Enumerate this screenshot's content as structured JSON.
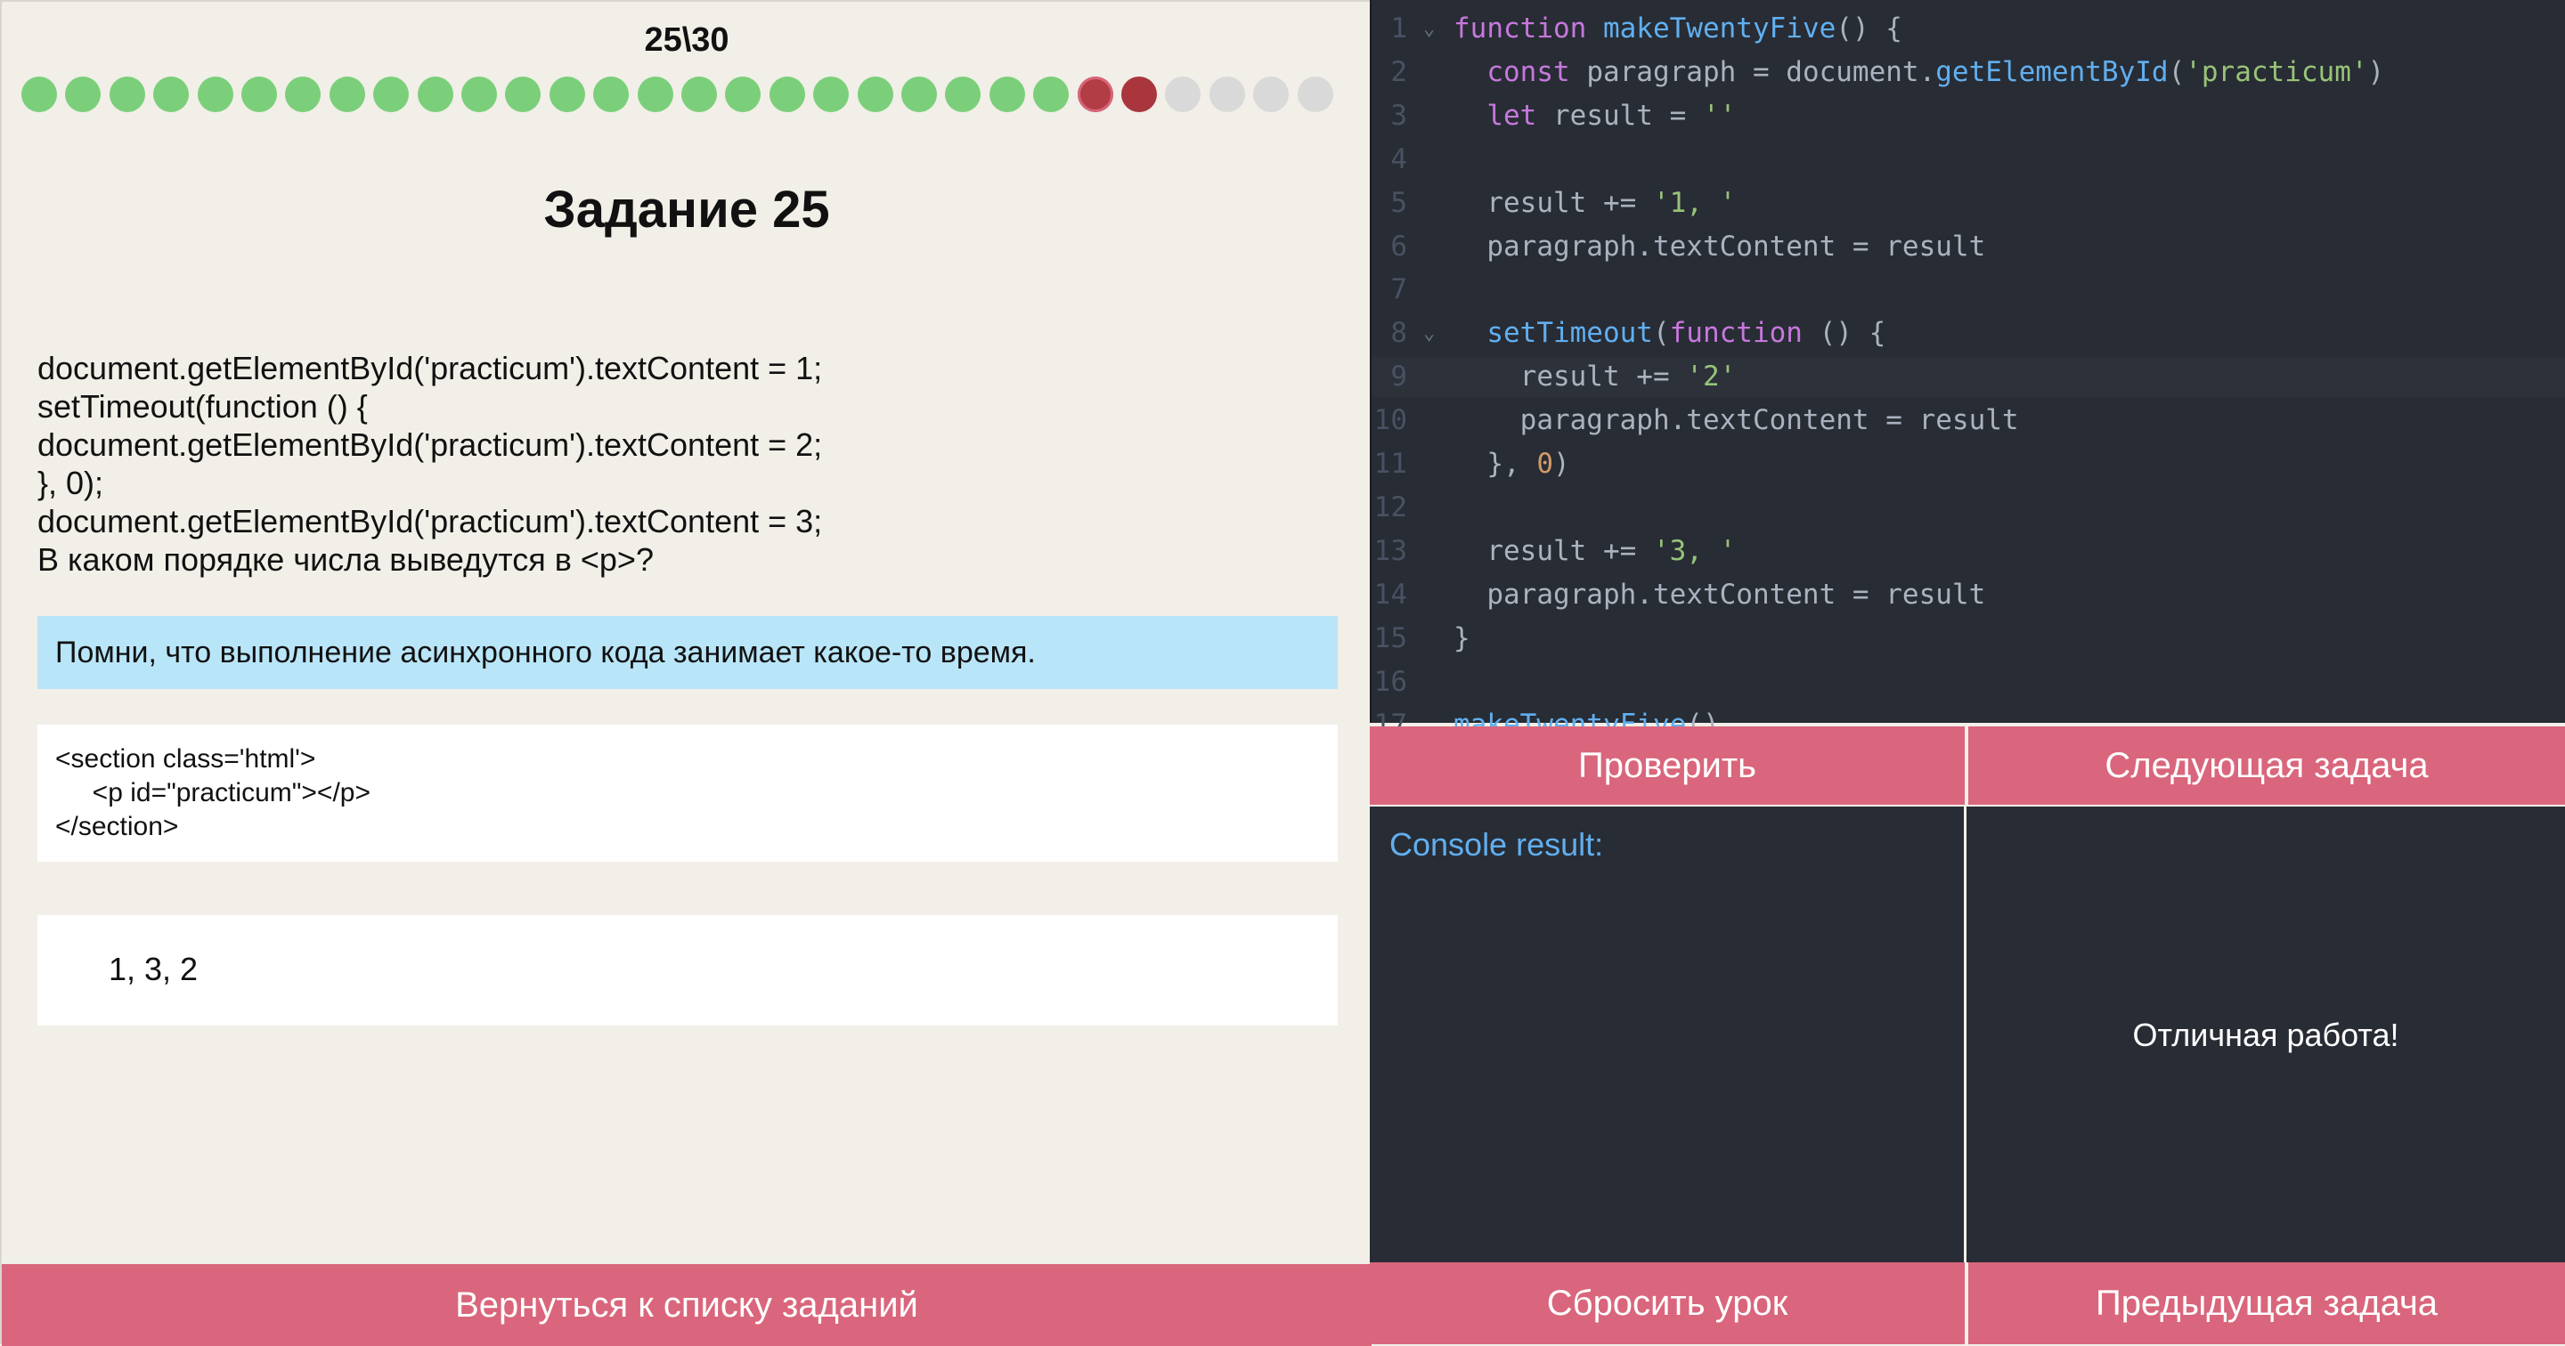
{
  "progress": {
    "counter": "25\\30",
    "dots": [
      "done",
      "done",
      "done",
      "done",
      "done",
      "done",
      "done",
      "done",
      "done",
      "done",
      "done",
      "done",
      "done",
      "done",
      "done",
      "done",
      "done",
      "done",
      "done",
      "done",
      "done",
      "done",
      "done",
      "done",
      "current",
      "wrong",
      "pending",
      "pending",
      "pending",
      "pending"
    ]
  },
  "task": {
    "title": "Задание 25",
    "lines": [
      "document.getElementById('practicum').textContent = 1;",
      "setTimeout(function () {",
      "document.getElementById('practicum').textContent = 2;",
      "}, 0);",
      "document.getElementById('practicum').textContent = 3;",
      "В каком порядке числа выведутся в <p>?"
    ],
    "hint": "Помни, что выполнение асинхронного кода занимает какое-то время.",
    "html_lines": [
      "<section class='html'>",
      "     <p id=\"practicum\"></p>",
      "</section>"
    ],
    "answer": "1, 3, 2",
    "back_label": "Вернуться к списку заданий"
  },
  "editor": {
    "active_line": 9,
    "folds": [
      1,
      8
    ],
    "lines": [
      [
        [
          "kw",
          "function"
        ],
        [
          "p",
          " "
        ],
        [
          "fn",
          "makeTwentyFive"
        ],
        [
          "p",
          "() {"
        ]
      ],
      [
        [
          "p",
          "  "
        ],
        [
          "kw",
          "const"
        ],
        [
          "p",
          " paragraph = document."
        ],
        [
          "fn",
          "getElementById"
        ],
        [
          "p",
          "("
        ],
        [
          "str",
          "'practicum'"
        ],
        [
          "p",
          ")"
        ]
      ],
      [
        [
          "p",
          "  "
        ],
        [
          "kw",
          "let"
        ],
        [
          "p",
          " result = "
        ],
        [
          "str",
          "''"
        ]
      ],
      [],
      [
        [
          "p",
          "  result += "
        ],
        [
          "str",
          "'1, '"
        ]
      ],
      [
        [
          "p",
          "  paragraph.textContent = result"
        ]
      ],
      [],
      [
        [
          "p",
          "  "
        ],
        [
          "fn",
          "setTimeout"
        ],
        [
          "p",
          "("
        ],
        [
          "kw",
          "function"
        ],
        [
          "p",
          " () {"
        ]
      ],
      [
        [
          "p",
          "    result += "
        ],
        [
          "str",
          "'2'"
        ]
      ],
      [
        [
          "p",
          "    paragraph.textContent = result"
        ]
      ],
      [
        [
          "p",
          "  }, "
        ],
        [
          "num",
          "0"
        ],
        [
          "p",
          ")"
        ]
      ],
      [],
      [
        [
          "p",
          "  result += "
        ],
        [
          "str",
          "'3, '"
        ]
      ],
      [
        [
          "p",
          "  paragraph.textContent = result"
        ]
      ],
      [
        [
          "p",
          "}"
        ]
      ],
      [],
      [
        [
          "fn",
          "makeTwentyFive"
        ],
        [
          "p",
          "()"
        ]
      ]
    ]
  },
  "buttons": {
    "check": "Проверить",
    "next": "Следующая задача",
    "reset": "Сбросить урок",
    "prev": "Предыдущая задача"
  },
  "console": {
    "label": "Console result:"
  },
  "result": {
    "text": "Отличная работа!"
  },
  "colors": {
    "button": "#d9667c",
    "done_dot": "#7bcf7a",
    "wrong_dot": "#a9363d",
    "pending_dot": "#d9d9d9",
    "hint_bg": "#b9e5f8",
    "editor_bg": "#282c34"
  }
}
